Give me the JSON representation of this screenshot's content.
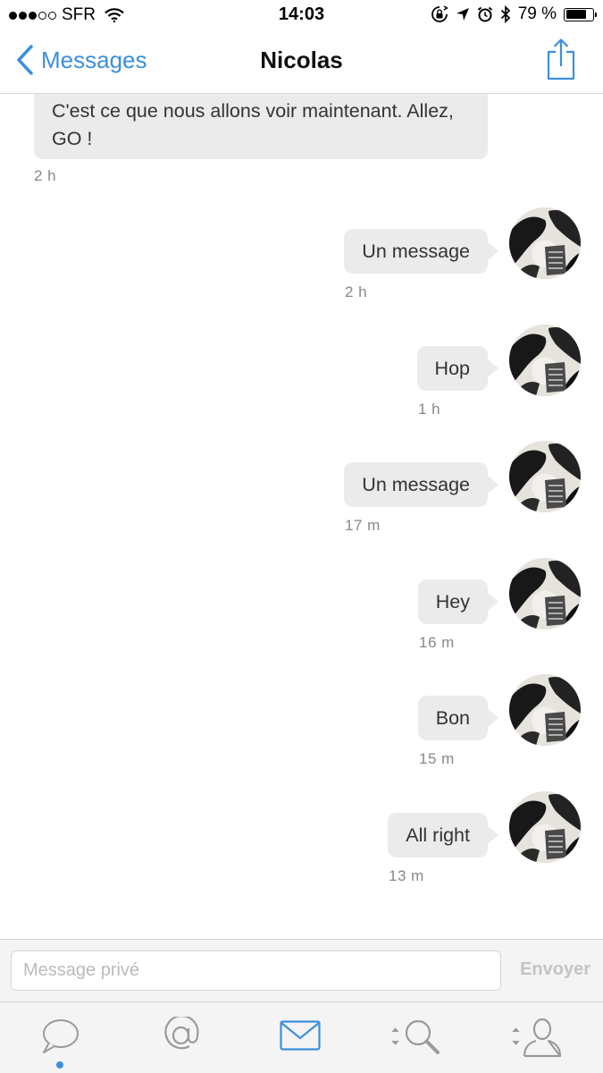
{
  "status_bar": {
    "carrier": "SFR",
    "time": "14:03",
    "battery": "79 %",
    "battery_level": 0.79,
    "signal_bars_filled": 3,
    "signal_bars_total": 5,
    "icons": [
      "signal-dots-icon",
      "wifi-icon",
      "rotation-lock-icon",
      "location-arrow-icon",
      "alarm-icon",
      "bluetooth-icon",
      "battery-icon"
    ]
  },
  "nav": {
    "back_label": "Messages",
    "title": "Nicolas",
    "share_icon": "share-icon",
    "accent_color": "#3c8fdc"
  },
  "thread": {
    "incoming": {
      "text": "C'est ce que nous allons voir maintenant. Allez, GO !",
      "time": "2 h"
    },
    "outgoing": [
      {
        "text": "Un message",
        "time": "2 h"
      },
      {
        "text": "Hop",
        "time": "1 h"
      },
      {
        "text": "Un message",
        "time": "17 m"
      },
      {
        "text": "Hey",
        "time": "16 m"
      },
      {
        "text": "Bon",
        "time": "15 m"
      },
      {
        "text": "All right",
        "time": "13 m"
      }
    ]
  },
  "composer": {
    "placeholder": "Message privé",
    "value": "",
    "send_label": "Envoyer"
  },
  "tab_bar": {
    "tabs": [
      {
        "icon": "speech-bubble-icon",
        "active": false,
        "badge": true
      },
      {
        "icon": "at-sign-icon",
        "active": false
      },
      {
        "icon": "envelope-icon",
        "active": true
      },
      {
        "icon": "search-icon",
        "active": false
      },
      {
        "icon": "user-icon",
        "active": false
      }
    ]
  }
}
